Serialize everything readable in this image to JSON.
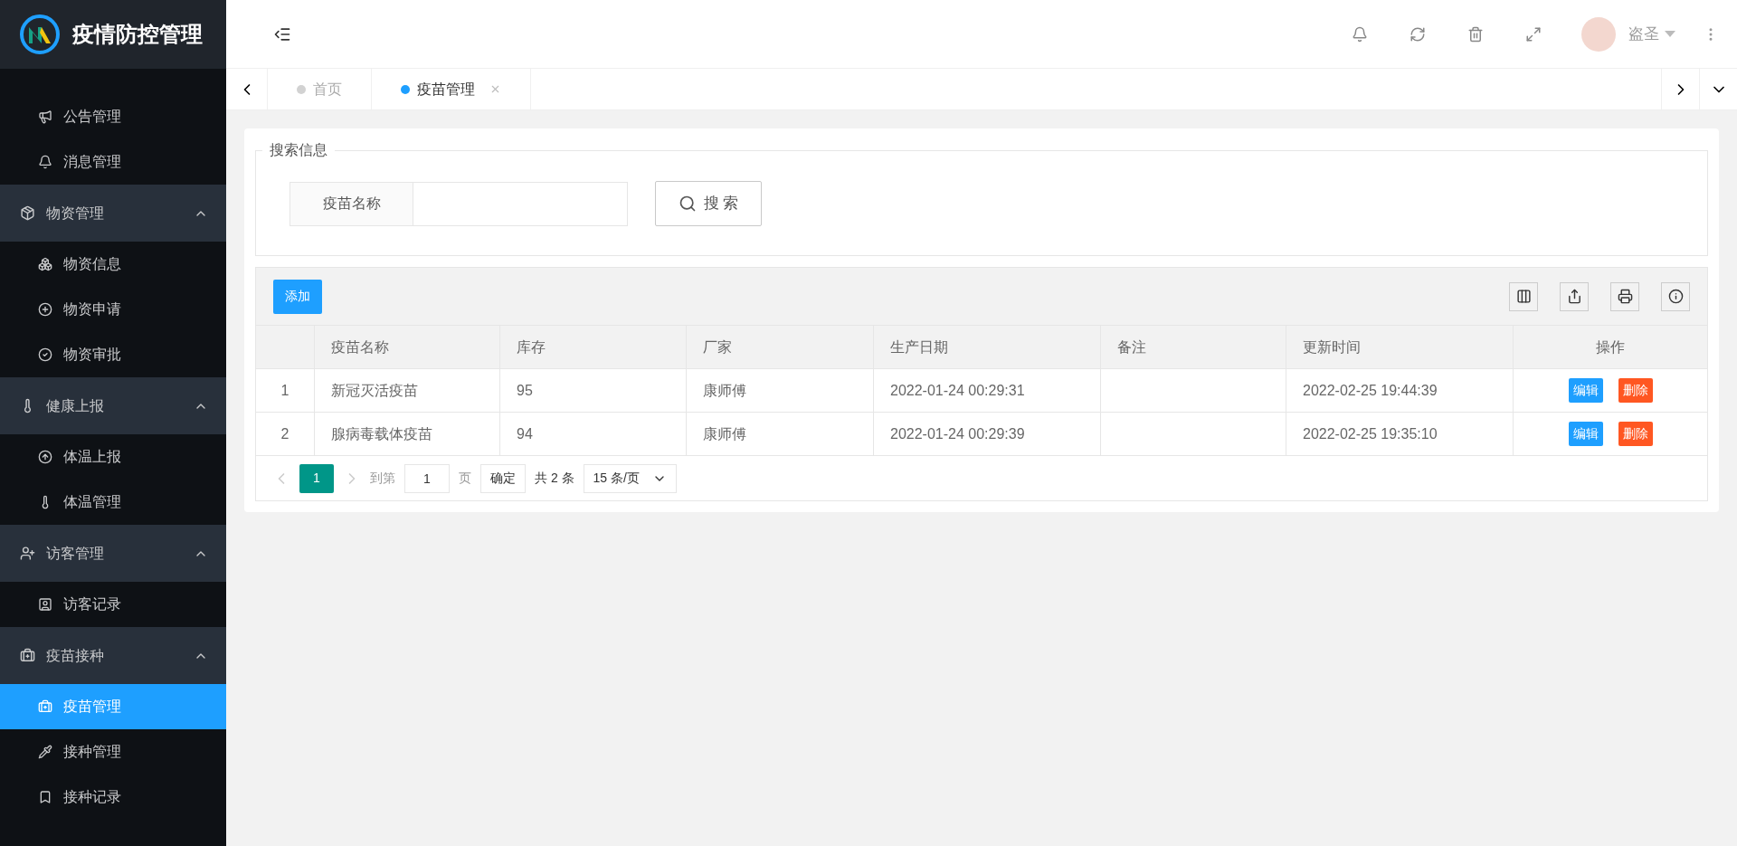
{
  "app": {
    "title": "疫情防控管理"
  },
  "sidebar": {
    "entries": [
      {
        "kind": "item",
        "label": "公告管理",
        "selected": false
      },
      {
        "kind": "item",
        "label": "消息管理",
        "selected": false
      },
      {
        "kind": "group",
        "label": "物资管理",
        "expanded": true,
        "children": [
          {
            "label": "物资信息",
            "selected": false
          },
          {
            "label": "物资申请",
            "selected": false
          },
          {
            "label": "物资审批",
            "selected": false
          }
        ]
      },
      {
        "kind": "group",
        "label": "健康上报",
        "expanded": true,
        "children": [
          {
            "label": "体温上报",
            "selected": false
          },
          {
            "label": "体温管理",
            "selected": false
          }
        ]
      },
      {
        "kind": "group",
        "label": "访客管理",
        "expanded": true,
        "children": [
          {
            "label": "访客记录",
            "selected": false
          }
        ]
      },
      {
        "kind": "group",
        "label": "疫苗接种",
        "expanded": true,
        "children": [
          {
            "label": "疫苗管理",
            "selected": true
          },
          {
            "label": "接种管理",
            "selected": false
          },
          {
            "label": "接种记录",
            "selected": false
          }
        ]
      }
    ]
  },
  "header": {
    "user": "盗圣"
  },
  "tabs": [
    {
      "label": "首页",
      "selected": false,
      "closable": false
    },
    {
      "label": "疫苗管理",
      "selected": true,
      "closable": true
    }
  ],
  "search": {
    "legend": "搜索信息",
    "field_label": "疫苗名称",
    "button": "搜 索"
  },
  "toolbar": {
    "add_button": "添加"
  },
  "table": {
    "columns": [
      "",
      "疫苗名称",
      "库存",
      "厂家",
      "生产日期",
      "备注",
      "更新时间",
      "操作"
    ],
    "rows": [
      {
        "cells": [
          "1",
          "新冠灭活疫苗",
          "95",
          "康师傅",
          "2022-01-24 00:29:31",
          "",
          "2022-02-25 19:44:39"
        ],
        "actions": [
          "编辑",
          "删除"
        ]
      },
      {
        "cells": [
          "2",
          "腺病毒载体疫苗",
          "94",
          "康师傅",
          "2022-01-24 00:29:39",
          "",
          "2022-02-25 19:35:10"
        ],
        "actions": [
          "编辑",
          "删除"
        ]
      }
    ]
  },
  "pagination": {
    "pages": [
      {
        "label": "1",
        "selected": true
      }
    ],
    "goto_label": "到第",
    "goto_value": "1",
    "page_unit": "页",
    "confirm": "确定",
    "total": "共 2 条",
    "page_size": "15 条/页"
  }
}
